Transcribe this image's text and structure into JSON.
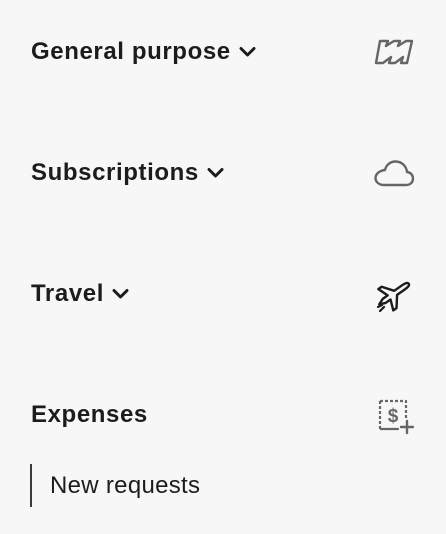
{
  "sections": [
    {
      "title": "General purpose",
      "icon": "general-purpose-icon",
      "has_chevron": true
    },
    {
      "title": "Subscriptions",
      "icon": "cloud-icon",
      "has_chevron": true
    },
    {
      "title": "Travel",
      "icon": "airplane-icon",
      "has_chevron": true
    },
    {
      "title": "Expenses",
      "icon": "receipt-add-icon",
      "has_chevron": false
    }
  ],
  "expenses_items": [
    {
      "label": "New requests"
    }
  ],
  "colors": {
    "background": "#f7f7f7",
    "text": "#1c1c1c",
    "icon_muted": "#666666",
    "icon_dark": "#1c1c1c"
  }
}
